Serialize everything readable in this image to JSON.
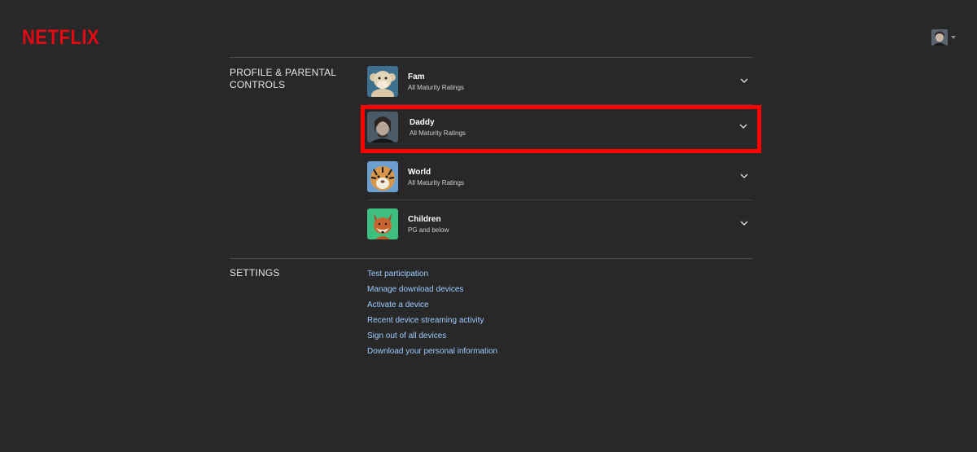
{
  "brand": {
    "logo_text": "NETFLIX",
    "color": "#e50914"
  },
  "header": {
    "avatar_icon": "account-avatar-icon",
    "caret_icon": "caret-down-icon"
  },
  "profile_section": {
    "title": "PROFILE & PARENTAL CONTROLS",
    "profiles": [
      {
        "name": "Fam",
        "rating": "All Maturity Ratings",
        "avatar": "stuffed-monkey-avatar",
        "highlighted": false
      },
      {
        "name": "Daddy",
        "rating": "All Maturity Ratings",
        "avatar": "man-portrait-avatar",
        "highlighted": true
      },
      {
        "name": "World",
        "rating": "All Maturity Ratings",
        "avatar": "tiger-avatar",
        "highlighted": false
      },
      {
        "name": "Children",
        "rating": "PG and below",
        "avatar": "fox-avatar",
        "highlighted": false
      }
    ]
  },
  "settings_section": {
    "title": "SETTINGS",
    "links": [
      "Test participation",
      "Manage download devices",
      "Activate a device",
      "Recent device streaming activity",
      "Sign out of all devices",
      "Download your personal information"
    ]
  },
  "colors": {
    "background": "#282828",
    "link": "#9ccbff",
    "highlight_border": "#ff0000"
  }
}
